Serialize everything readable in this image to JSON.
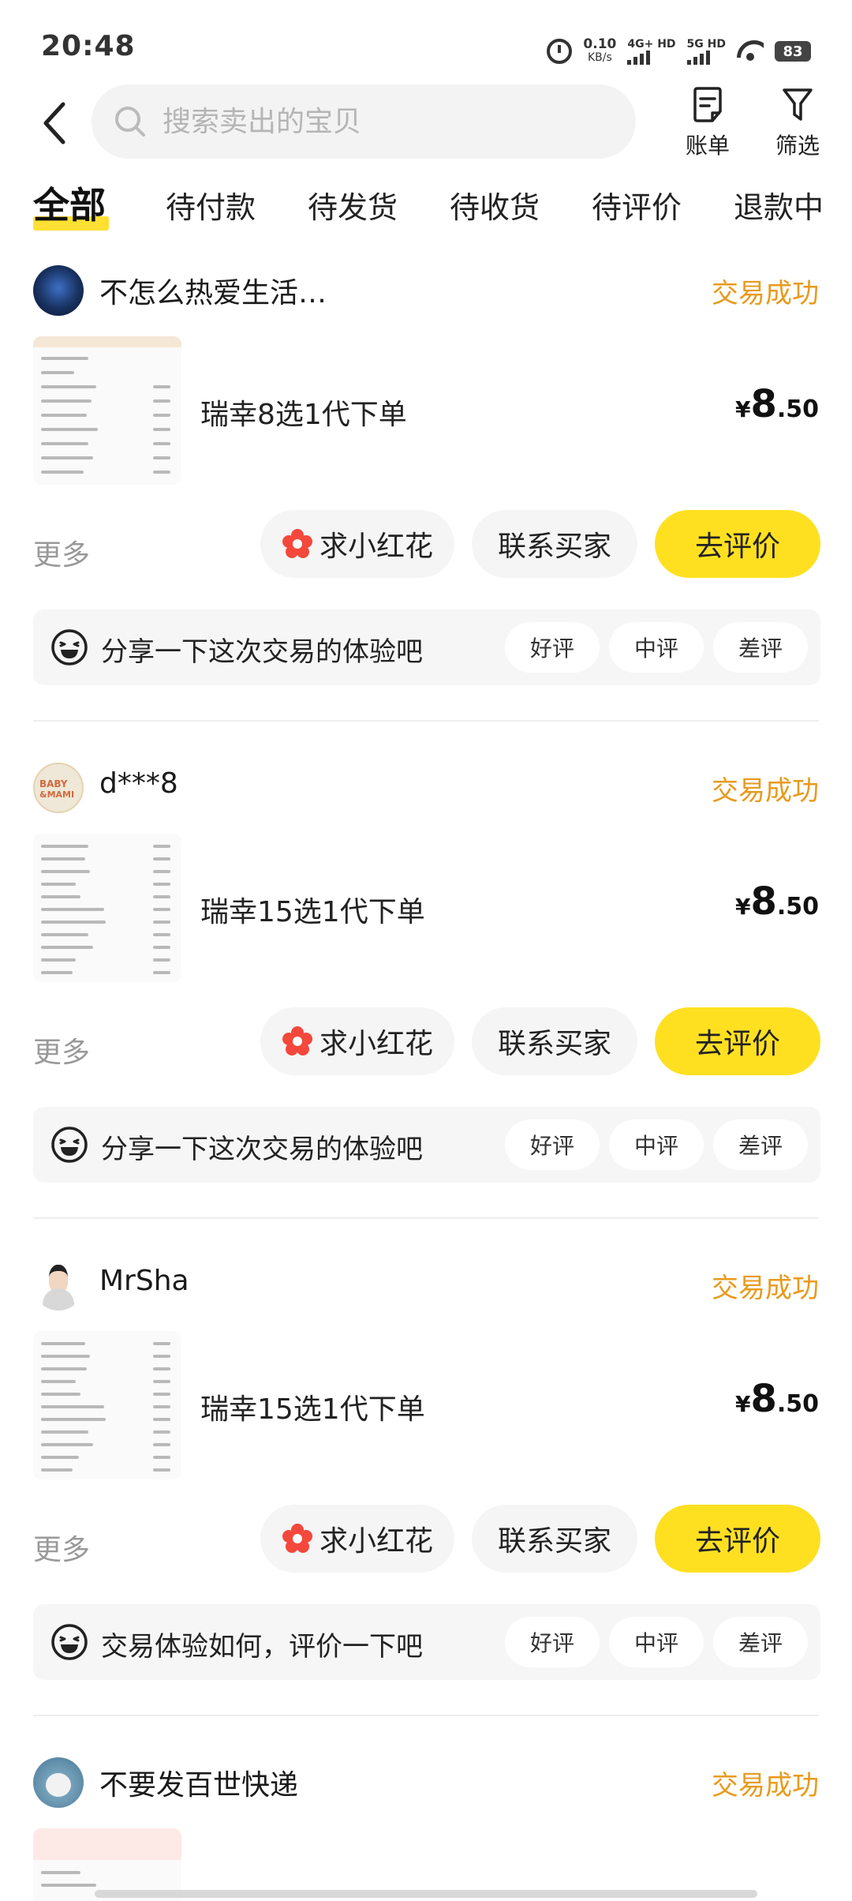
{
  "status_bar": {
    "time": "20:48",
    "net_speed": "0.10",
    "net_unit": "KB/s",
    "sim1": "4G+ HD",
    "sim2": "5G HD",
    "battery": "83"
  },
  "header": {
    "search_placeholder": "搜索卖出的宝贝",
    "bill_label": "账单",
    "filter_label": "筛选"
  },
  "tabs": [
    {
      "label": "全部",
      "active": true
    },
    {
      "label": "待付款"
    },
    {
      "label": "待发货"
    },
    {
      "label": "待收货"
    },
    {
      "label": "待评价"
    },
    {
      "label": "退款中"
    }
  ],
  "accent_colors": {
    "yellow": "#ffe021",
    "status_orange": "#e89a1c",
    "flower_red": "#f4483c"
  },
  "orders": [
    {
      "seller": "不怎么热爱生活…",
      "status": "交易成功",
      "title": "瑞幸8选1代下单",
      "price_currency": "¥",
      "price_int": "8",
      "price_dec": ".50",
      "more": "更多",
      "btn_flower": "求小红花",
      "btn_contact": "联系买家",
      "btn_review": "去评价",
      "share_text": "分享一下这次交易的体验吧",
      "rate_good": "好评",
      "rate_mid": "中评",
      "rate_bad": "差评"
    },
    {
      "seller": "d***8",
      "status": "交易成功",
      "title": "瑞幸15选1代下单",
      "price_currency": "¥",
      "price_int": "8",
      "price_dec": ".50",
      "more": "更多",
      "btn_flower": "求小红花",
      "btn_contact": "联系买家",
      "btn_review": "去评价",
      "share_text": "分享一下这次交易的体验吧",
      "rate_good": "好评",
      "rate_mid": "中评",
      "rate_bad": "差评"
    },
    {
      "seller": "MrSha",
      "status": "交易成功",
      "title": "瑞幸15选1代下单",
      "price_currency": "¥",
      "price_int": "8",
      "price_dec": ".50",
      "more": "更多",
      "btn_flower": "求小红花",
      "btn_contact": "联系买家",
      "btn_review": "去评价",
      "share_text": "交易体验如何，评价一下吧",
      "rate_good": "好评",
      "rate_mid": "中评",
      "rate_bad": "差评"
    },
    {
      "seller": "不要发百世快递",
      "status": "交易成功"
    }
  ]
}
